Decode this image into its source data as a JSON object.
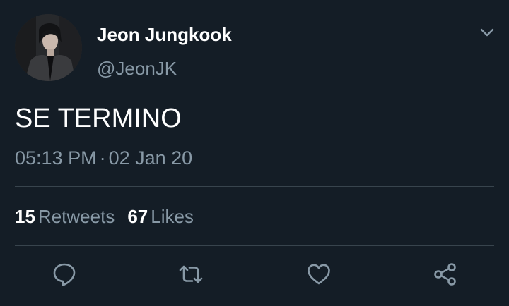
{
  "tweet": {
    "author": {
      "display_name": "Jeon Jungkook",
      "handle": "@JeonJK",
      "avatar_icon": "profile-photo"
    },
    "text": "SE TERMINO",
    "time": "05:13 PM",
    "separator": "·",
    "date": "02 Jan 20",
    "retweets": {
      "count": "15",
      "label": "Retweets"
    },
    "likes": {
      "count": "67",
      "label": "Likes"
    }
  },
  "actions": [
    {
      "name": "reply",
      "icon": "speech-bubble-icon"
    },
    {
      "name": "retweet",
      "icon": "retweet-arrows-icon"
    },
    {
      "name": "like",
      "icon": "heart-icon"
    },
    {
      "name": "share",
      "icon": "share-nodes-icon"
    }
  ],
  "colors": {
    "background": "#141d26",
    "primary_text": "#ffffff",
    "secondary_text": "#8899a6",
    "divider": "#38444d"
  }
}
